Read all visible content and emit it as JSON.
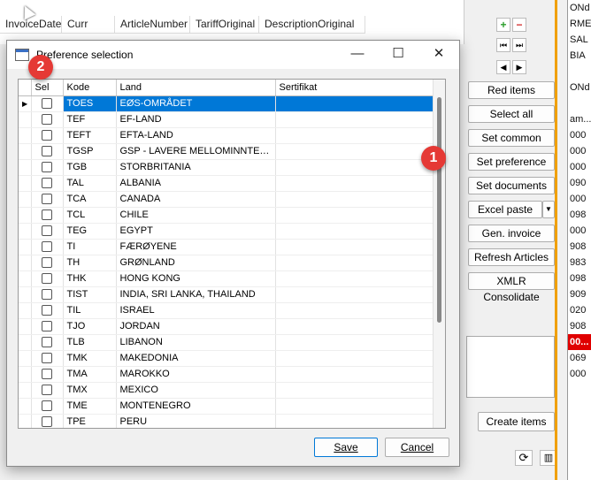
{
  "background": {
    "columns": [
      "InvoiceDate",
      "Curr",
      "ArticleNumber",
      "TariffOriginal",
      "DescriptionOriginal"
    ],
    "right_strip": [
      "ONd",
      "RMEt",
      "SAL",
      "BIA",
      "",
      "ONd",
      "",
      "am...",
      "000",
      "000",
      "000",
      "090",
      "000",
      "098",
      "000",
      "908",
      "983",
      "098",
      "909",
      "020",
      "908",
      "00...",
      "069",
      "000"
    ]
  },
  "side_buttons": {
    "red_items": "Red items",
    "select_all": "Select all",
    "set_common": "Set common",
    "set_preference": "Set preference",
    "set_documents": "Set documents",
    "excel_paste": "Excel paste",
    "gen_invoice": "Gen. invoice",
    "refresh_articles": "Refresh Articles",
    "xmlr_consolidate": "XMLR Consolidate",
    "create_items": "Create items"
  },
  "dialog": {
    "title": "Preference selection",
    "headers": [
      "Sel",
      "Kode",
      "Land",
      "Sertifikat"
    ],
    "rows": [
      {
        "kode": "TOES",
        "land": "EØS-OMRÅDET",
        "sertifikat": ""
      },
      {
        "kode": "TEF",
        "land": "EF-LAND",
        "sertifikat": ""
      },
      {
        "kode": "TEFT",
        "land": "EFTA-LAND",
        "sertifikat": ""
      },
      {
        "kode": "TGSP",
        "land": "GSP - LAVERE MELLOMINNTEKTSLAND",
        "sertifikat": ""
      },
      {
        "kode": "TGB",
        "land": "STORBRITANIA",
        "sertifikat": ""
      },
      {
        "kode": "TAL",
        "land": "ALBANIA",
        "sertifikat": ""
      },
      {
        "kode": "TCA",
        "land": "CANADA",
        "sertifikat": ""
      },
      {
        "kode": "TCL",
        "land": "CHILE",
        "sertifikat": ""
      },
      {
        "kode": "TEG",
        "land": "EGYPT",
        "sertifikat": ""
      },
      {
        "kode": "TI",
        "land": "FÆRØYENE",
        "sertifikat": ""
      },
      {
        "kode": "TH",
        "land": "GRØNLAND",
        "sertifikat": ""
      },
      {
        "kode": "THK",
        "land": "HONG KONG",
        "sertifikat": ""
      },
      {
        "kode": "TIST",
        "land": "INDIA, SRI LANKA, THAILAND",
        "sertifikat": ""
      },
      {
        "kode": "TIL",
        "land": "ISRAEL",
        "sertifikat": ""
      },
      {
        "kode": "TJO",
        "land": "JORDAN",
        "sertifikat": ""
      },
      {
        "kode": "TLB",
        "land": "LIBANON",
        "sertifikat": ""
      },
      {
        "kode": "TMK",
        "land": "MAKEDONIA",
        "sertifikat": ""
      },
      {
        "kode": "TMA",
        "land": "MAROKKO",
        "sertifikat": ""
      },
      {
        "kode": "TMX",
        "land": "MEXICO",
        "sertifikat": ""
      },
      {
        "kode": "TME",
        "land": "MONTENEGRO",
        "sertifikat": ""
      },
      {
        "kode": "TPE",
        "land": "PERU",
        "sertifikat": ""
      }
    ],
    "save": "Save",
    "cancel": "Cancel"
  },
  "annotations": {
    "badge1": "1",
    "badge2": "2"
  },
  "colors": {
    "selection": "#0078d7",
    "badge": "#e53935"
  }
}
